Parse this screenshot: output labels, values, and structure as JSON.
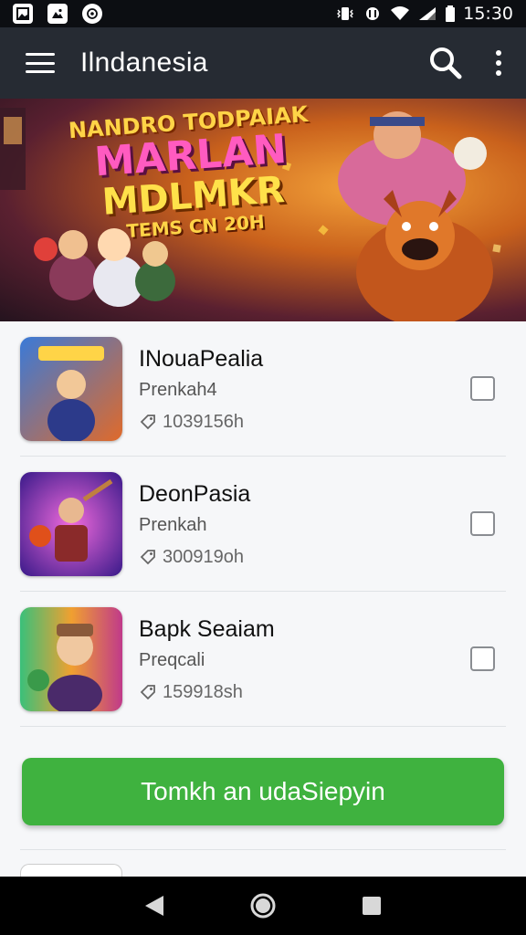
{
  "status_bar": {
    "time": "15:30",
    "left_icons": [
      "gallery-icon",
      "photo-icon",
      "whatsapp-icon"
    ],
    "right_icons": [
      "vibrate-icon",
      "data-icon",
      "wifi-icon",
      "signal-icon",
      "battery-icon"
    ]
  },
  "app_bar": {
    "title": "Ilndanesia",
    "icons": [
      "menu-icon",
      "search-icon",
      "more-vert-icon"
    ]
  },
  "banner": {
    "line1": "NANDRO TODPAIAK",
    "line2": "MARLAN",
    "line3": "MDLMKR",
    "line4": "TEMS CN 20H"
  },
  "list": {
    "items": [
      {
        "title": "INouaPealia",
        "subtitle": "Prenkah4",
        "meta": "1039156h",
        "checked": false
      },
      {
        "title": "DeonPasia",
        "subtitle": "Prenkah",
        "meta": "300919oh",
        "checked": false
      },
      {
        "title": "Bapk Seaiam",
        "subtitle": "Preqcali",
        "meta": "159918sh",
        "checked": false
      }
    ]
  },
  "cta": {
    "label": "Tomkh an udaSiepyin"
  },
  "colors": {
    "app_bar": "#262b33",
    "cta": "#3fb23f",
    "status_bar": "#0c0e12"
  },
  "nav": {
    "icons": [
      "back-icon",
      "home-icon",
      "recents-icon"
    ]
  }
}
